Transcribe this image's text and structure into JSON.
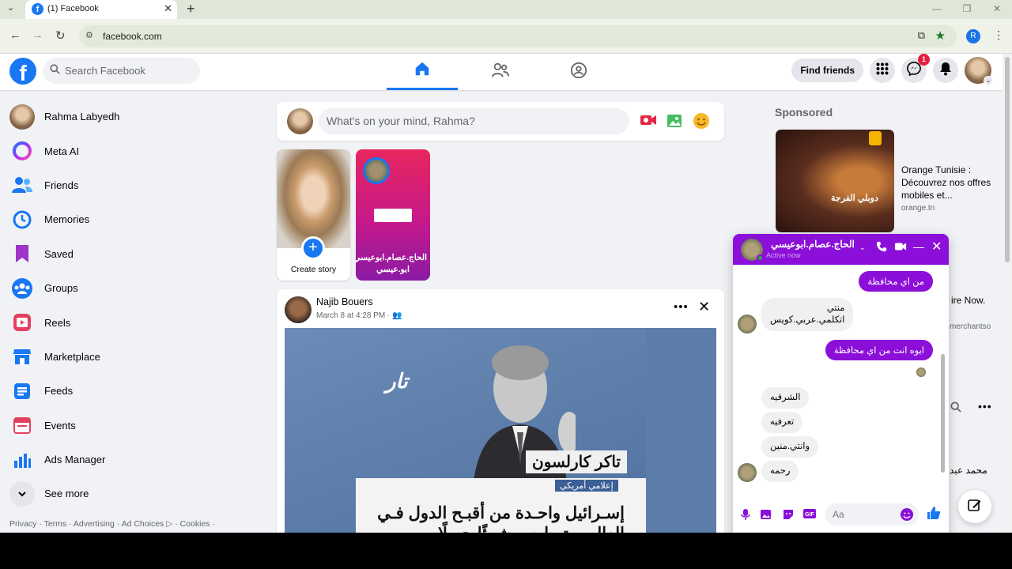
{
  "browser": {
    "tab_title": "(1) Facebook",
    "tab_favicon_letter": "f",
    "url": "facebook.com",
    "profile_letter": "R"
  },
  "header": {
    "logo_letter": "f",
    "search_placeholder": "Search Facebook",
    "find_friends_label": "Find friends",
    "messenger_badge": "1"
  },
  "sidebar": {
    "items": [
      {
        "label": "Rahma Labyedh",
        "icon": "user-avatar"
      },
      {
        "label": "Meta AI",
        "icon": "meta-ai-icon"
      },
      {
        "label": "Friends",
        "icon": "friends-icon"
      },
      {
        "label": "Memories",
        "icon": "memories-icon"
      },
      {
        "label": "Saved",
        "icon": "saved-icon"
      },
      {
        "label": "Groups",
        "icon": "groups-icon"
      },
      {
        "label": "Reels",
        "icon": "reels-icon"
      },
      {
        "label": "Marketplace",
        "icon": "marketplace-icon"
      },
      {
        "label": "Feeds",
        "icon": "feeds-icon"
      },
      {
        "label": "Events",
        "icon": "events-icon"
      },
      {
        "label": "Ads Manager",
        "icon": "ads-manager-icon"
      },
      {
        "label": "See more",
        "icon": "chevron-down-icon"
      }
    ],
    "footer": "Privacy · Terms · Advertising · Ad Choices ▷ · Cookies ·"
  },
  "composer": {
    "placeholder": "What's on your mind, Rahma?"
  },
  "stories": {
    "create_label": "Create story",
    "story2_name": "الحاج.عصام.ابوعيسي. ابو.عيسي"
  },
  "post": {
    "author": "Najib Bouers",
    "time": "March 8 at 4:28 PM · ",
    "image_logo": "تار",
    "image_title": "تاكر كارلسون",
    "image_tag": "إعلامي أمريكي",
    "image_headline": "إسـرائيل واحـدة من أقبـح الدول فـي العالـم وتمـارس شـيئًا جميلًا"
  },
  "right": {
    "sponsored_label": "Sponsored",
    "ad_title": "Orange Tunisie : Découvrez nos offres mobiles et...",
    "ad_url": "orange.tn",
    "ad_image_text": "دوبلي الفرجة",
    "partial_text_1": "ire Now.",
    "partial_text_2": "merchantso",
    "partial_contact": "محمد عبد"
  },
  "chat": {
    "name": "الحاج.عصام.ابوعيسي",
    "status": "Active now",
    "input_placeholder": "Aa",
    "messages": [
      {
        "dir": "out",
        "text": "من اي محافظة"
      },
      {
        "dir": "in",
        "text": "منتي\nاتكلمي.عربي.كويس"
      },
      {
        "dir": "out",
        "text": "ايوه انت من اي محافظة"
      },
      {
        "dir": "in",
        "text": "الشرقيه"
      },
      {
        "dir": "in",
        "text": "تعرفيه"
      },
      {
        "dir": "in",
        "text": "وانتي.منين"
      },
      {
        "dir": "in",
        "text": "رحمه"
      }
    ]
  },
  "colors": {
    "fb_blue": "#1877f2",
    "chat_purple": "#8b0fd8",
    "page_bg": "#f0f2f5"
  }
}
